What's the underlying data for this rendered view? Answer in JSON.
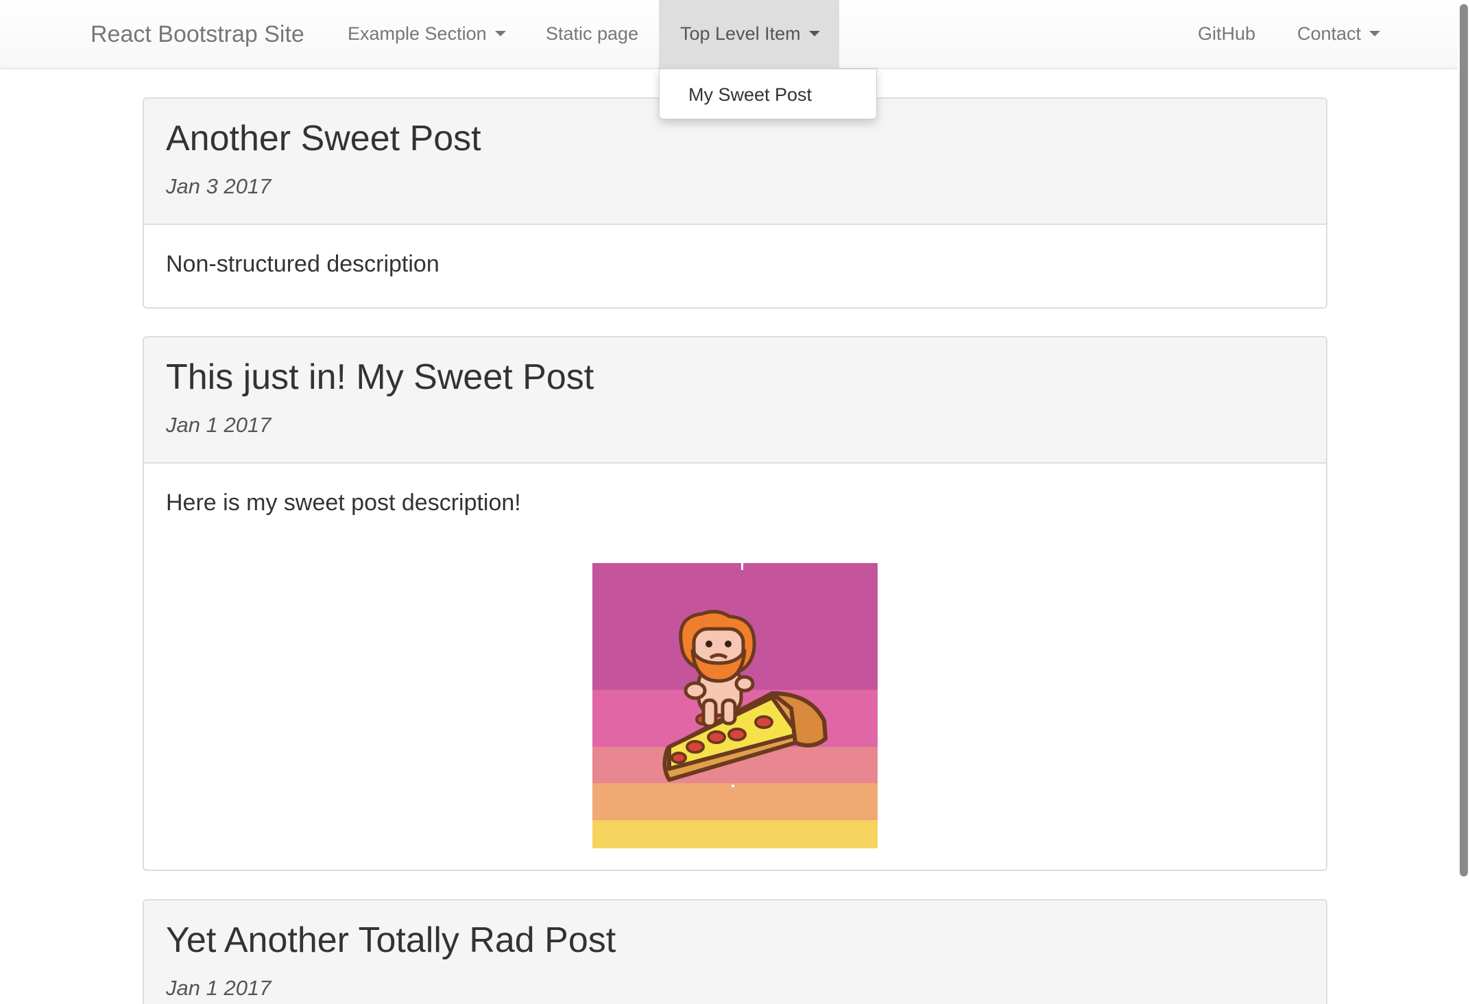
{
  "navbar": {
    "brand": "React Bootstrap Site",
    "items": [
      {
        "label": "Example Section",
        "has_caret": true
      },
      {
        "label": "Static page",
        "has_caret": false
      },
      {
        "label": "Top Level Item",
        "has_caret": true,
        "active": true
      },
      {
        "label": "GitHub",
        "has_caret": false
      },
      {
        "label": "Contact",
        "has_caret": true
      }
    ],
    "dropdown": {
      "items": [
        {
          "label": "My Sweet Post"
        }
      ]
    }
  },
  "posts": [
    {
      "title": "Another Sweet Post",
      "date": "Jan 3 2017",
      "description": "Non-structured description"
    },
    {
      "title": "This just in! My Sweet Post",
      "date": "Jan 1 2017",
      "description": "Here is my sweet post description!",
      "image": "pizza-surfer-illustration"
    },
    {
      "title": "Yet Another Totally Rad Post",
      "date": "Jan 1 2017"
    }
  ],
  "colors": {
    "navbar_text": "#777777",
    "active_item_bg": "#dedede",
    "panel_heading_bg": "#f5f5f5",
    "panel_border": "#dddddd",
    "image_stripes": [
      "#c4559c",
      "#e066a6",
      "#e8878f",
      "#f0a972",
      "#f5d35e"
    ]
  }
}
